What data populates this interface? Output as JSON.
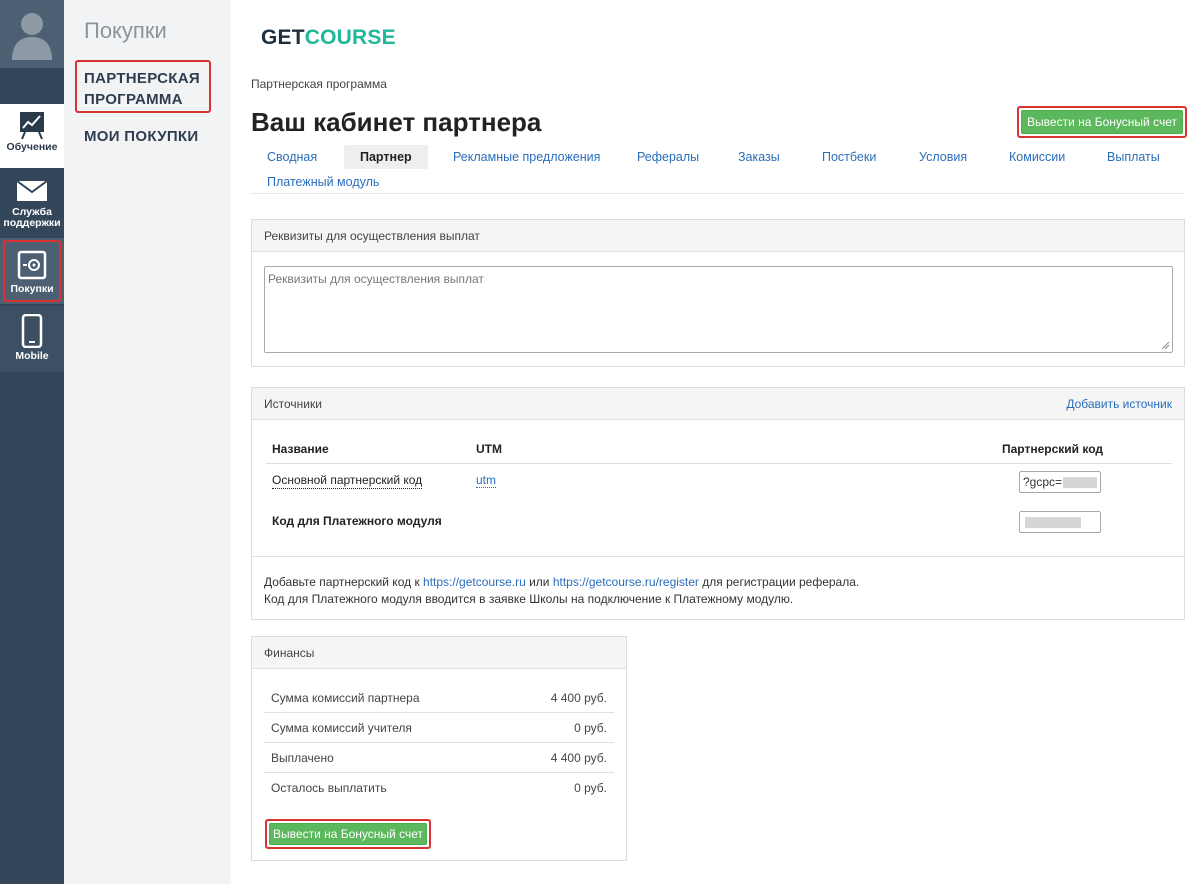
{
  "sidebar": {
    "items": [
      {
        "label": "Обучение"
      },
      {
        "label": "Служба поддержки"
      },
      {
        "label": "Покупки"
      },
      {
        "label": "Mobile"
      }
    ]
  },
  "subnav": {
    "title": "Покупки",
    "partner_line1": "ПАРТНЕРСКАЯ",
    "partner_line2": "ПРОГРАММА",
    "mine": "МОИ ПОКУПКИ"
  },
  "logo": {
    "get": "GET",
    "course": "COURSE"
  },
  "breadcrumb": "Партнерская программа",
  "page_title": "Ваш кабинет партнера",
  "top_button": "Вывести на Бонусный счет",
  "tabs": [
    {
      "label": "Сводная"
    },
    {
      "label": "Партнер"
    },
    {
      "label": "Рекламные предложения"
    },
    {
      "label": "Рефералы"
    },
    {
      "label": "Заказы"
    },
    {
      "label": "Постбеки"
    },
    {
      "label": "Условия"
    },
    {
      "label": "Комиссии"
    },
    {
      "label": "Выплаты"
    },
    {
      "label": "Платежный модуль"
    }
  ],
  "requisites": {
    "header": "Реквизиты для осуществления выплат",
    "placeholder": "Реквизиты для осуществления выплат"
  },
  "sources": {
    "header": "Источники",
    "add": "Добавить источник",
    "columns": {
      "name": "Название",
      "utm": "UTM",
      "code": "Партнерский код"
    },
    "rows": [
      {
        "name": "Основной партнерский код",
        "utm": "utm",
        "code": "?gcpc="
      },
      {
        "name": "Код для Платежного модуля"
      }
    ],
    "note": {
      "p1": "Добавьте партнерский код к ",
      "link1": "https://getcourse.ru",
      "p2": " или ",
      "link2": "https://getcourse.ru/register",
      "p3": " для регистрации реферала.",
      "line2": "Код для Платежного модуля вводится в заявке Школы на подключение к Платежному модулю."
    }
  },
  "finance": {
    "header": "Финансы",
    "rows": [
      {
        "k": "Сумма комиссий партнера",
        "v": "4 400 руб."
      },
      {
        "k": "Сумма комиссий учителя",
        "v": "0 руб."
      },
      {
        "k": "Выплачено",
        "v": "4 400 руб."
      },
      {
        "k": "Осталось выплатить",
        "v": "0 руб."
      }
    ],
    "button": "Вывести на Бонусный счет"
  }
}
